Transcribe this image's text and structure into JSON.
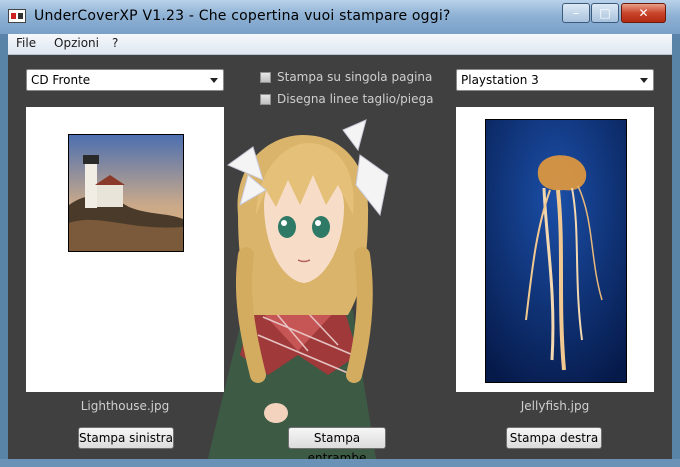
{
  "window": {
    "title": "UnderCoverXP V1.23 - Che copertina vuoi stampare oggi?",
    "icon": "undercover-app-icon",
    "controls": {
      "minimize": "–",
      "maximize": "□",
      "close": "✕"
    }
  },
  "menu": [
    {
      "label": "File"
    },
    {
      "label": "Opzioni"
    },
    {
      "label": "?"
    }
  ],
  "left": {
    "select_value": "CD Fronte",
    "filename": "Lighthouse.jpg",
    "button_label": "Stampa sinistra"
  },
  "center": {
    "options": [
      {
        "label": "Stampa su singola pagina",
        "checked": false
      },
      {
        "label": "Disegna linee taglio/piega",
        "checked": false
      }
    ],
    "button_label": "Stampa entrambe"
  },
  "right": {
    "select_value": "Playstation 3",
    "filename": "Jellyfish.jpg",
    "button_label": "Stampa destra"
  },
  "colors": {
    "client_bg": "#404040",
    "titlebar": "#8fb2d5",
    "label_text": "#cfcfcf"
  }
}
